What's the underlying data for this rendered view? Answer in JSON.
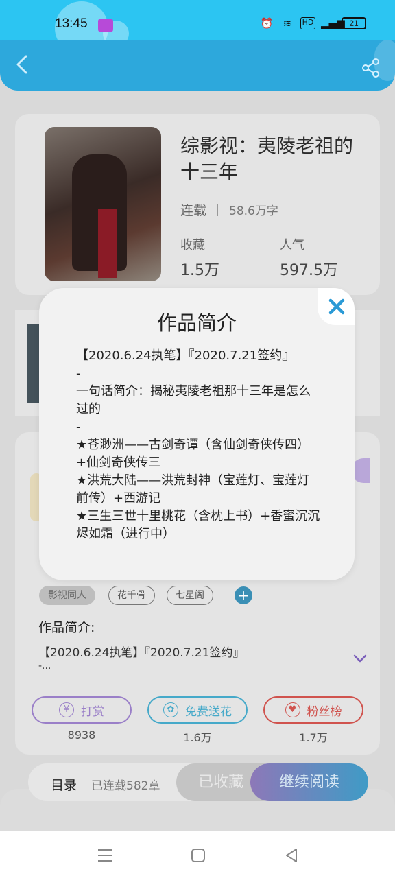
{
  "status_bar": {
    "time": "13:45",
    "battery": "21",
    "icons": [
      "alarm-icon",
      "wifi-icon",
      "hd-icon",
      "signal-icon"
    ]
  },
  "header": {
    "back_icon": "chevron-left-icon",
    "share_icon": "share-icon"
  },
  "book": {
    "title": "综影视：夷陵老祖的十三年",
    "status": "连载",
    "word_count": "58.6万字",
    "collect_label": "收藏",
    "collect_value": "1.5万",
    "popularity_label": "人气",
    "popularity_value": "597.5万"
  },
  "tags": [
    "影视同人",
    "花千骨",
    "七星阁"
  ],
  "intro": {
    "heading": "作品简介:",
    "preview": "【2020.6.24执笔】『2020.7.21签约』",
    "more": "-..."
  },
  "actions": [
    {
      "label": "打赏",
      "icon": "coin-icon",
      "count": "8938",
      "color": "#9a7fc8"
    },
    {
      "label": "免费送花",
      "icon": "flower-icon",
      "count": "1.6万",
      "color": "#45a9c9"
    },
    {
      "label": "粉丝榜",
      "icon": "user-heart-icon",
      "count": "1.7万",
      "color": "#d0534e"
    }
  ],
  "bottom_bar": {
    "toc_label": "目录",
    "chapters": "已连载582章",
    "collected_label": "已收藏",
    "read_label": "继续阅读"
  },
  "modal": {
    "title": "作品简介",
    "lines": [
      "【2020.6.24执笔】『2020.7.21签约』",
      "-",
      "一句话简介：揭秘夷陵老祖那十三年是怎么过的",
      "-",
      "★苍渺洲——古剑奇谭（含仙剑奇侠传四）+仙剑奇侠传三",
      "★洪荒大陆——洪荒封神（宝莲灯、宝莲灯前传）+西游记",
      "★三生三世十里桃花（含枕上书）+香蜜沉沉烬如霜（进行中）"
    ],
    "close_icon": "close-icon"
  },
  "colors": {
    "header": "#2da8dc",
    "status_bar": "#2cc5f2",
    "close_x": "#2a9ad6"
  }
}
